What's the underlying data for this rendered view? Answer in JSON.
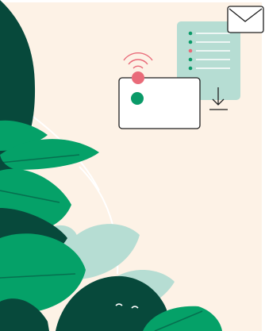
{
  "illustration": {
    "background_color": "#fdf2e6",
    "edge_color": "#ffffff",
    "leaf_dark": "#07493b",
    "leaf_green": "#05a168",
    "leaf_pale": "#b6ddd3",
    "outline_color": "#1e1e1e",
    "card_fill": "#ffffff",
    "accent_pink": "#e96b79",
    "accent_green": "#0a9a68",
    "document_fill": "#b6ddd3",
    "document_line_color": "#ffffff",
    "document_bullet_colors": [
      "#0a9a68",
      "#0a9a68",
      "#e96b79",
      "#0a9a68",
      "#0a9a68"
    ],
    "icons": [
      "envelope-icon",
      "document-list-icon",
      "download-icon",
      "wireless-signal-icon",
      "id-card-icon",
      "monstera-leaf-icon"
    ]
  }
}
